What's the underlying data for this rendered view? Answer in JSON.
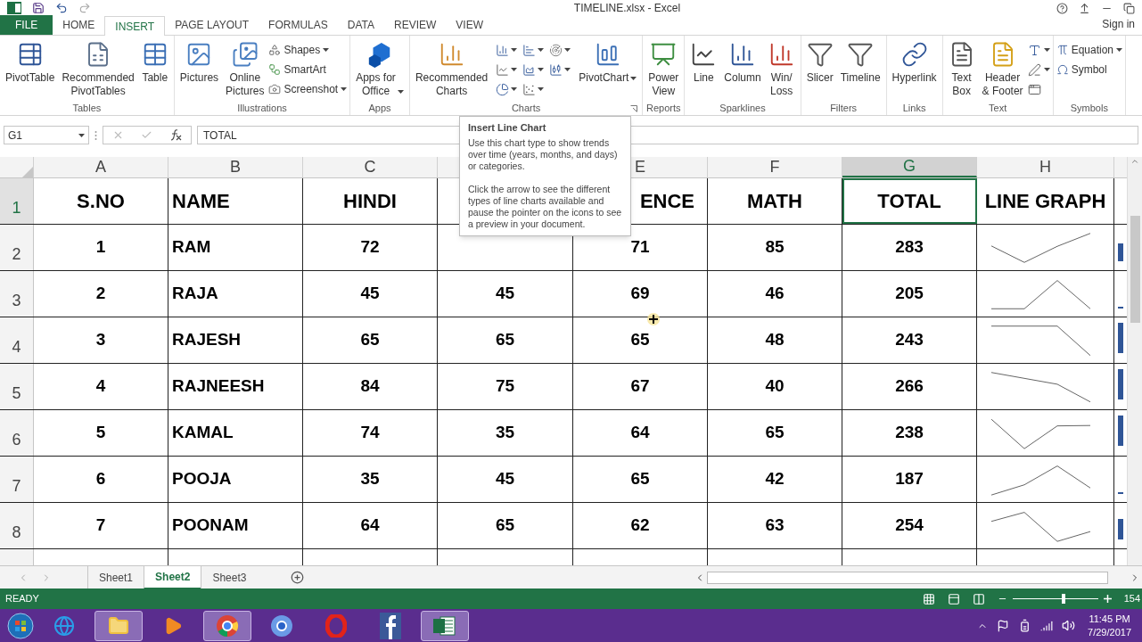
{
  "title_bar": {
    "title": "TIMELINE.xlsx - Excel"
  },
  "menu_tabs": [
    {
      "label": "FILE",
      "kind": "file",
      "selected": false
    },
    {
      "label": "HOME",
      "kind": "tab",
      "selected": false
    },
    {
      "label": "INSERT",
      "kind": "tab",
      "selected": true
    },
    {
      "label": "PAGE LAYOUT",
      "kind": "tab",
      "selected": false
    },
    {
      "label": "FORMULAS",
      "kind": "tab",
      "selected": false
    },
    {
      "label": "DATA",
      "kind": "tab",
      "selected": false
    },
    {
      "label": "REVIEW",
      "kind": "tab",
      "selected": false
    },
    {
      "label": "VIEW",
      "kind": "tab",
      "selected": false
    }
  ],
  "sign_in": "Sign in",
  "ribbon": [
    {
      "label": "Tables",
      "items": [
        {
          "kind": "large",
          "label": "PivotTable",
          "dropdown": false
        },
        {
          "kind": "large",
          "label": "Recommended\nPivotTables",
          "dropdown": false
        },
        {
          "kind": "large",
          "label": "Table",
          "dropdown": false
        }
      ]
    },
    {
      "label": "Illustrations",
      "items": [
        {
          "kind": "large",
          "label": "Pictures",
          "dropdown": false
        },
        {
          "kind": "large",
          "label": "Online\nPictures",
          "dropdown": false
        },
        {
          "kind": "stack",
          "entries": [
            {
              "label": "Shapes",
              "dropdown": true
            },
            {
              "label": "SmartArt",
              "dropdown": false
            },
            {
              "label": "Screenshot",
              "dropdown": true
            }
          ]
        }
      ]
    },
    {
      "label": "Apps",
      "items": [
        {
          "kind": "large",
          "label": "Apps for\nOffice",
          "dropdown": true
        }
      ]
    },
    {
      "label": "Charts",
      "launcher": true,
      "items": [
        {
          "kind": "large",
          "label": "Recommended\nCharts",
          "dropdown": false
        },
        {
          "kind": "grid",
          "buttons": [
            {
              "dropdown": true
            },
            {
              "dropdown": true
            },
            {
              "dropdown": true
            },
            {
              "dropdown": true
            },
            {
              "dropdown": true
            },
            {
              "dropdown": true
            },
            {
              "dropdown": true
            },
            {
              "dropdown": true
            }
          ]
        },
        {
          "kind": "large",
          "label": "PivotChart",
          "dropdown": true
        }
      ]
    },
    {
      "label": "Reports",
      "items": [
        {
          "kind": "large",
          "label": "Power\nView",
          "dropdown": false
        }
      ]
    },
    {
      "label": "Sparklines",
      "items": [
        {
          "kind": "large",
          "label": "Line",
          "dropdown": false
        },
        {
          "kind": "large",
          "label": "Column",
          "dropdown": false
        },
        {
          "kind": "large",
          "label": "Win/\nLoss",
          "dropdown": false
        }
      ]
    },
    {
      "label": "Filters",
      "items": [
        {
          "kind": "large",
          "label": "Slicer",
          "dropdown": false
        },
        {
          "kind": "large",
          "label": "Timeline",
          "dropdown": false
        }
      ]
    },
    {
      "label": "Links",
      "items": [
        {
          "kind": "large",
          "label": "Hyperlink",
          "dropdown": false
        }
      ]
    },
    {
      "label": "Text",
      "items": [
        {
          "kind": "large",
          "label": "Text\nBox",
          "dropdown": false
        },
        {
          "kind": "large",
          "label": "Header\n& Footer",
          "dropdown": false
        },
        {
          "kind": "icons",
          "buttons": [
            {
              "dropdown": true
            },
            {
              "dropdown": true
            },
            {
              "dropdown": false
            }
          ]
        }
      ]
    },
    {
      "label": "Symbols",
      "items": [
        {
          "kind": "stack",
          "entries": [
            {
              "label": "Equation",
              "dropdown": true
            },
            {
              "label": "Symbol",
              "dropdown": false
            }
          ]
        }
      ]
    }
  ],
  "formula_bar": {
    "name_box": "G1",
    "formula": "TOTAL"
  },
  "tooltip": {
    "title": "Insert Line Chart",
    "paragraphs": [
      "Use this chart type to show trends over time (years, months, and days) or categories.",
      "Click the arrow to see the different types of line charts available and pause the pointer on the icons to see a preview in your document."
    ]
  },
  "columns": [
    {
      "label": "A",
      "selected": false
    },
    {
      "label": "B",
      "selected": false
    },
    {
      "label": "C",
      "selected": false
    },
    {
      "selected": false
    },
    {
      "label": "E",
      "selected": false
    },
    {
      "label": "F",
      "selected": false
    },
    {
      "label": "G",
      "selected": true
    },
    {
      "label": "H",
      "selected": false
    }
  ],
  "rows": [
    {
      "header": "1",
      "kind": "heading",
      "selected": true,
      "cells": [
        "S.NO",
        "NAME",
        "HINDI",
        null,
        "ENCE",
        "MATH",
        "TOTAL",
        "LINE GRAPH"
      ]
    },
    {
      "header": "2",
      "kind": "data",
      "selected": false,
      "cells": [
        "1",
        "RAM",
        "72",
        null,
        "71",
        "85",
        "283"
      ]
    },
    {
      "header": "3",
      "kind": "data",
      "selected": false,
      "cells": [
        "2",
        "RAJA",
        "45",
        "45",
        "69",
        "46",
        "205"
      ]
    },
    {
      "header": "4",
      "kind": "data",
      "selected": false,
      "cells": [
        "3",
        "RAJESH",
        "65",
        "65",
        "65",
        "48",
        "243"
      ]
    },
    {
      "header": "5",
      "kind": "data",
      "selected": false,
      "cells": [
        "4",
        "RAJNEESH",
        "84",
        "75",
        "67",
        "40",
        "266"
      ]
    },
    {
      "header": "6",
      "kind": "data",
      "selected": false,
      "cells": [
        "5",
        "KAMAL",
        "74",
        "35",
        "64",
        "65",
        "238"
      ]
    },
    {
      "header": "7",
      "kind": "data",
      "selected": false,
      "cells": [
        "6",
        "POOJA",
        "35",
        "45",
        "65",
        "42",
        "187"
      ]
    },
    {
      "header": "8",
      "kind": "data",
      "selected": false,
      "cells": [
        "7",
        "POONAM",
        "64",
        "65",
        "62",
        "63",
        "254"
      ]
    }
  ],
  "sheets": [
    {
      "label": "Sheet1",
      "selected": false
    },
    {
      "label": "Sheet2",
      "selected": true
    },
    {
      "label": "Sheet3",
      "selected": false
    }
  ],
  "status_bar": {
    "status": "READY",
    "zoom": "154",
    "zoom_slider": {
      "level": 0.6
    }
  },
  "taskbar": {
    "apps": [
      {
        "active": false
      },
      {
        "active": true
      },
      {
        "active": false
      },
      {
        "active": true
      },
      {
        "active": false
      },
      {
        "active": false
      },
      {
        "active": false
      },
      {
        "active": true
      }
    ],
    "time": "11:45 PM",
    "date": "7/29/2017"
  }
}
